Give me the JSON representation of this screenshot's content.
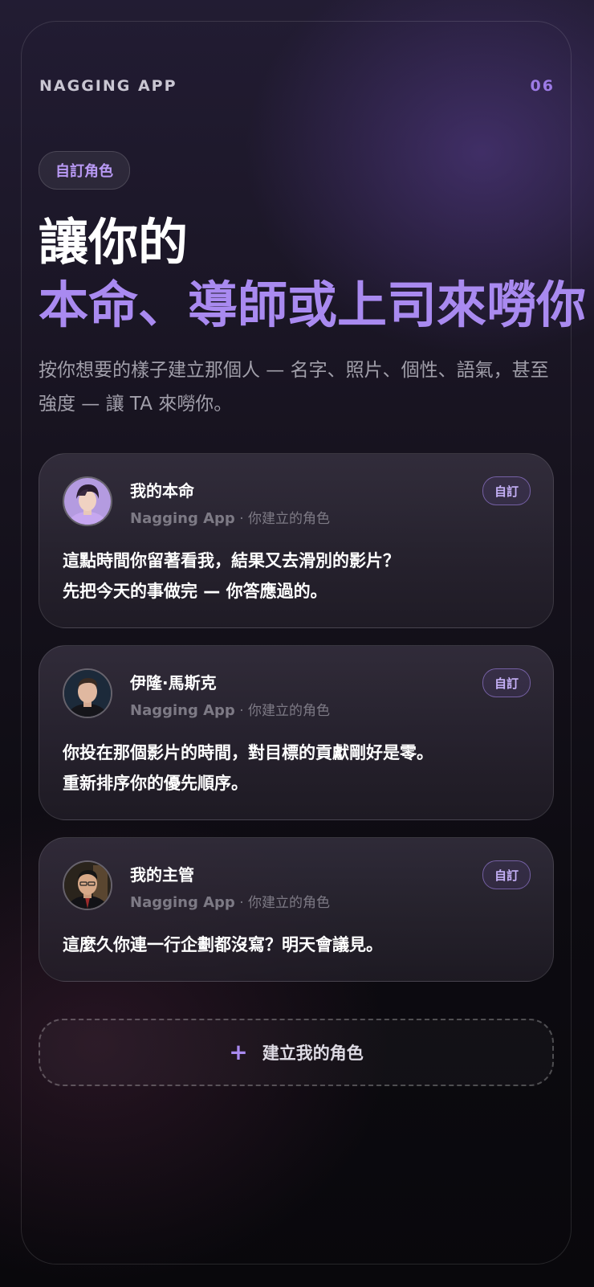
{
  "header": {
    "app_name": "NAGGING APP",
    "page_number": "06"
  },
  "tag": "自訂角色",
  "title": {
    "line1": "讓你的",
    "line2": "本命、導師或上司來嘮你"
  },
  "subtitle": "按你想要的樣子建立那個人 — 名字、照片、個性、語氣，甚至強度 — 讓 TA 來嘮你。",
  "cards": [
    {
      "name": "我的本命",
      "meta_app": "Nagging App",
      "meta_sep": " · ",
      "meta_role": "你建立的角色",
      "badge": "自訂",
      "message_line1": "這點時間你留著看我，結果又去滑別的影片？",
      "message_line2": "先把今天的事做完 — 你答應過的。",
      "avatar_icon": "idol-avatar-icon"
    },
    {
      "name": "伊隆·馬斯克",
      "meta_app": "Nagging App",
      "meta_sep": " · ",
      "meta_role": "你建立的角色",
      "badge": "自訂",
      "message_line1": "你投在那個影片的時間，對目標的貢獻剛好是零。",
      "message_line2": "重新排序你的優先順序。",
      "avatar_icon": "mentor-avatar-icon"
    },
    {
      "name": "我的主管",
      "meta_app": "Nagging App",
      "meta_sep": " · ",
      "meta_role": "你建立的角色",
      "badge": "自訂",
      "message_line1": "這麼久你連一行企劃都沒寫？明天會議見。",
      "avatar_icon": "boss-avatar-icon"
    }
  ],
  "create_button": {
    "icon": "+",
    "label": "建立我的角色"
  },
  "colors": {
    "accent": "#a98af0",
    "background": "#17131f"
  }
}
